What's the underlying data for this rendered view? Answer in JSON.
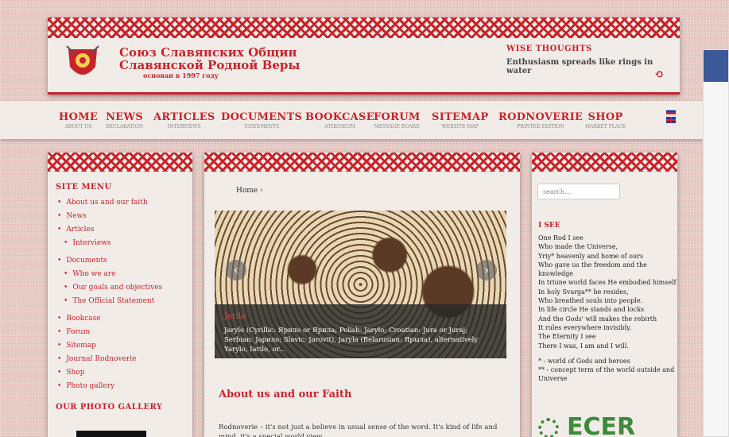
{
  "header": {
    "title_line1": "Союз Славянских Общин",
    "title_line2": "Славянской Родной Веры",
    "subtitle": "основан в 1997 году",
    "wise_title": "WISE THOUGHTS",
    "wise_text": "Enthusiasm spreads like rings in water"
  },
  "nav": [
    {
      "label": "HOME",
      "sub": "ABOUT US"
    },
    {
      "label": "NEWS",
      "sub": "DECLARATION"
    },
    {
      "label": "ARTICLES",
      "sub": "INTERVIEWS"
    },
    {
      "label": "DOCUMENTS",
      "sub": "STATEMENTS"
    },
    {
      "label": "BOOKCASE",
      "sub": "ATHENEUM"
    },
    {
      "label": "FORUM",
      "sub": "MESSAGE BOARD"
    },
    {
      "label": "SITEMAP",
      "sub": "WEBSITE MAP"
    },
    {
      "label": "RODNOVERIE",
      "sub": "PRINTED EDITION"
    },
    {
      "label": "SHOP",
      "sub": "MARKET PLACE"
    }
  ],
  "sidebar": {
    "heading": "SITE MENU",
    "items": [
      {
        "label": "About us and our faith"
      },
      {
        "label": "News"
      },
      {
        "label": "Articles"
      },
      {
        "label": "Interviews"
      },
      {
        "label": "Documents"
      },
      {
        "label": "Who we are"
      },
      {
        "label": "Our goals and objectives"
      },
      {
        "label": "The Official Statement"
      },
      {
        "label": "Bookcase"
      },
      {
        "label": "Forum"
      },
      {
        "label": "Sitemap"
      },
      {
        "label": "Journal Rodnoverie"
      },
      {
        "label": "Shop"
      },
      {
        "label": "Photo gallery"
      }
    ],
    "gallery_heading": "OUR PHOTO GALLERY"
  },
  "main": {
    "breadcrumb": "Home",
    "slide_title": "Jarilo",
    "slide_text": "Jarylo (Cyrillic: Ярило or Ярила; Polish: Jaryło; Croatian: Jura or Juraj; Serbian: Јарило; Slavic: Jarovit), Jaryla (Belarusian: Ярыла), alternatively Yarylo, Iarilo, or...",
    "article_title": "About us and our Faith",
    "article_text": "Rodnoverie – it's not just a believe in usual sense of the word. It's kind of life and mind, it's a special world view."
  },
  "right": {
    "search_placeholder": "search...",
    "poem_title": "I SEE",
    "poem": [
      "One Rod I see",
      "Who made the Universe,",
      "Yriy* heavenly and home of ours",
      "Who gave us the freedom and the",
      "knowledge",
      "In triune world faces He embodied himself",
      "In holy Svarga** he resides,",
      "Who breathed souls into people.",
      "In life circle He stands and locks",
      "And the Gods' will makes the rebirth",
      "It rules everywhere invisibly.",
      "The Eternity I see",
      "There I was, I am and I will."
    ],
    "footnote1": "* - world of Gods and heroes",
    "footnote2": "** - concept term of the world outside and Universe",
    "ecer": "ECER"
  },
  "colors": {
    "accent": "#c8232b",
    "ecer_green": "#3d8b3a",
    "fb": "#3b5998"
  }
}
